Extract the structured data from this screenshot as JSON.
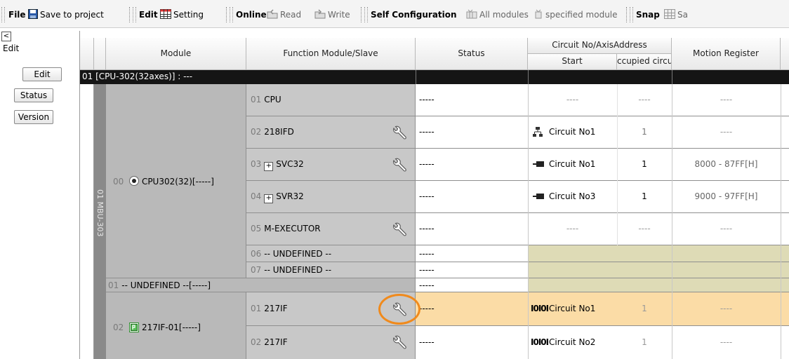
{
  "toolbar": {
    "file": "File",
    "save_to_project": "Save to project",
    "edit": "Edit",
    "setting": "Setting",
    "online": "Online",
    "read": "Read",
    "write": "Write",
    "self_configuration": "Self Configuration",
    "all_modules": "All modules",
    "specified_module": "specified module",
    "snap": "Snap",
    "cut_off": "Sa"
  },
  "left_panel": {
    "collapse_glyph": "<",
    "title": "Edit",
    "buttons": [
      "Edit",
      "Status",
      "Version"
    ]
  },
  "table": {
    "headers": {
      "module": "Module",
      "function_module": "Function Module/Slave",
      "status": "Status",
      "circuit_group": "Circuit No/AxisAddress",
      "start": "Start",
      "occupied": "ccupied circu",
      "motion_register": "Motion Register"
    },
    "cpu_row_label": "01 [CPU-302(32axes)] : ---",
    "rack_label": "01 MBU-303",
    "cpu_module": {
      "num": "00",
      "name": "CPU302(32)[-----]"
    },
    "undefined_module": {
      "num": "01",
      "name": "-- UNDEFINED --[-----]"
    },
    "if_module": {
      "num": "02",
      "name": "217IF-01[-----]"
    },
    "rows": [
      {
        "num": "01",
        "name": "CPU",
        "status": "-----",
        "circuit": "----",
        "occupied": "----",
        "motion": "----",
        "icon": ""
      },
      {
        "num": "02",
        "name": "218IFD",
        "status": "-----",
        "circuit": "Circuit No1",
        "occupied": "1",
        "motion": "----",
        "icon": "network-icon"
      },
      {
        "num": "03",
        "name": "SVC32",
        "status": "-----",
        "circuit": "Circuit No1",
        "occupied": "1",
        "motion": "8000 - 87FF[H]",
        "icon": "connector-icon"
      },
      {
        "num": "04",
        "name": "SVR32",
        "status": "-----",
        "circuit": "Circuit No3",
        "occupied": "1",
        "motion": "9000 - 97FF[H]",
        "icon": "connector-icon"
      },
      {
        "num": "05",
        "name": "M-EXECUTOR",
        "status": "-----",
        "circuit": "----",
        "occupied": "----",
        "motion": "----",
        "icon": ""
      },
      {
        "num": "06",
        "name": "-- UNDEFINED --",
        "status": "-----"
      },
      {
        "num": "07",
        "name": "-- UNDEFINED --",
        "status": "-----"
      },
      {
        "status": "-----"
      },
      {
        "num": "01",
        "name": "217IF",
        "status": "-----",
        "circuit": "Circuit No1",
        "occupied": "1",
        "motion": "----",
        "icon": "serial-icon",
        "io": "I0I0I"
      },
      {
        "num": "02",
        "name": "217IF",
        "status": "-----",
        "circuit": "Circuit No2",
        "occupied": "1",
        "motion": "----",
        "icon": "serial-icon",
        "io": "I0I0I"
      }
    ]
  },
  "colors": {
    "header_dark": "#151515",
    "module_gray": "#c4c4c4",
    "undefined_olive": "#dedbb6",
    "selected_row": "#fbdca6",
    "highlight_circle": "#f08a1c"
  }
}
